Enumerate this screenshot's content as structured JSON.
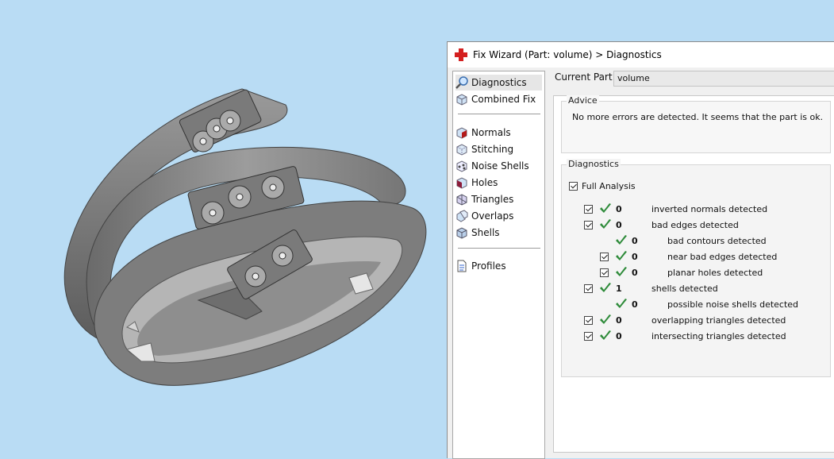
{
  "window": {
    "title": "Fix Wizard (Part: volume) > Diagnostics"
  },
  "sidebar": {
    "items": [
      {
        "label": "Diagnostics",
        "icon": "magnifier-icon"
      },
      {
        "label": "Combined Fix",
        "icon": "cube-icon"
      },
      {
        "label": "Normals",
        "icon": "normals-cube-icon"
      },
      {
        "label": "Stitching",
        "icon": "stitching-cube-icon"
      },
      {
        "label": "Noise Shells",
        "icon": "noise-shells-icon"
      },
      {
        "label": "Holes",
        "icon": "holes-cube-icon"
      },
      {
        "label": "Triangles",
        "icon": "triangles-icon"
      },
      {
        "label": "Overlaps",
        "icon": "overlaps-icon"
      },
      {
        "label": "Shells",
        "icon": "shells-icon"
      },
      {
        "label": "Profiles",
        "icon": "document-icon"
      }
    ],
    "selected": "Diagnostics"
  },
  "current_part": {
    "label": "Current Part:",
    "value": "volume"
  },
  "advice": {
    "legend": "Advice",
    "text": "No more errors are detected. It seems that the part is ok."
  },
  "diagnostics": {
    "legend": "Diagnostics",
    "full_analysis": {
      "label": "Full Analysis",
      "checked": true
    },
    "rows": [
      {
        "count": "0",
        "label": "inverted normals detected",
        "checkbox": true,
        "indent": 0
      },
      {
        "count": "0",
        "label": "bad edges detected",
        "checkbox": true,
        "indent": 0
      },
      {
        "count": "0",
        "label": "bad contours detected",
        "checkbox": false,
        "indent": 1
      },
      {
        "count": "0",
        "label": "near bad edges detected",
        "checkbox": true,
        "indent": 1
      },
      {
        "count": "0",
        "label": "planar holes detected",
        "checkbox": true,
        "indent": 1
      },
      {
        "count": "1",
        "label": "shells detected",
        "checkbox": true,
        "indent": 0
      },
      {
        "count": "0",
        "label": "possible noise shells detected",
        "checkbox": false,
        "indent": 1
      },
      {
        "count": "0",
        "label": "overlapping triangles detected",
        "checkbox": true,
        "indent": 0
      },
      {
        "count": "0",
        "label": "intersecting triangles detected",
        "checkbox": true,
        "indent": 0
      }
    ]
  },
  "colors": {
    "viewport_bg": "#b9dcf4",
    "tick_green": "#2e8b3a",
    "title_icon_red": "#d42020"
  }
}
